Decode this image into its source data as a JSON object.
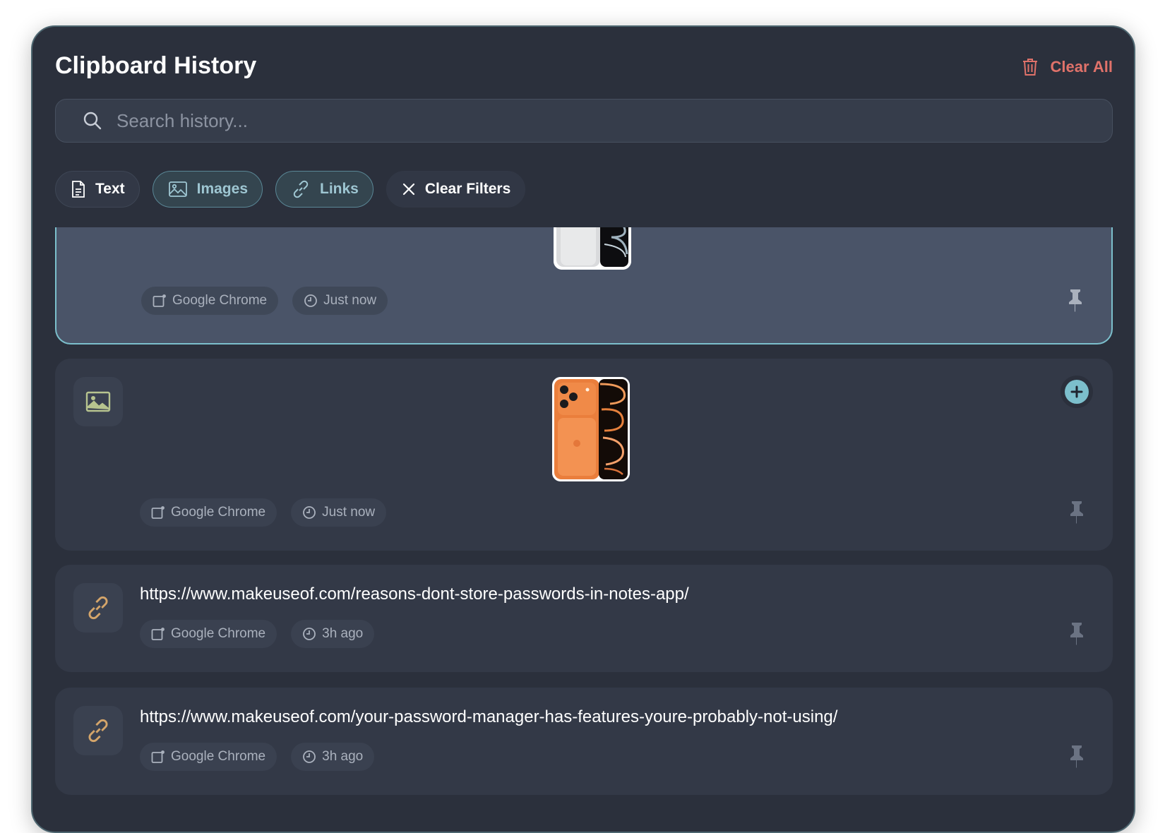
{
  "header": {
    "title": "Clipboard History",
    "clear_all_label": "Clear All"
  },
  "search": {
    "placeholder": "Search history...",
    "value": ""
  },
  "filters": [
    {
      "label": "Text",
      "icon": "document-icon",
      "active": false
    },
    {
      "label": "Images",
      "icon": "image-icon",
      "active": true
    },
    {
      "label": "Links",
      "icon": "link-icon",
      "active": true
    },
    {
      "label": "Clear Filters",
      "icon": "close-icon",
      "active": false
    }
  ],
  "items": [
    {
      "type": "image",
      "source": "Google Chrome",
      "time": "Just now",
      "image_desc": "silver phone image",
      "selected": true
    },
    {
      "type": "image",
      "source": "Google Chrome",
      "time": "Just now",
      "image_desc": "orange phone image",
      "selected": false
    },
    {
      "type": "link",
      "url": "https://www.makeuseof.com/reasons-dont-store-passwords-in-notes-app/",
      "source": "Google Chrome",
      "time": "3h ago"
    },
    {
      "type": "link",
      "url": "https://www.makeuseof.com/your-password-manager-has-features-youre-probably-not-using/",
      "source": "Google Chrome",
      "time": "3h ago"
    }
  ],
  "colors": {
    "background": "#2b303c",
    "accent": "#7cbfcc",
    "danger": "#e0726a",
    "link_icon": "#d4a56a",
    "image_icon": "#b7c48f"
  }
}
